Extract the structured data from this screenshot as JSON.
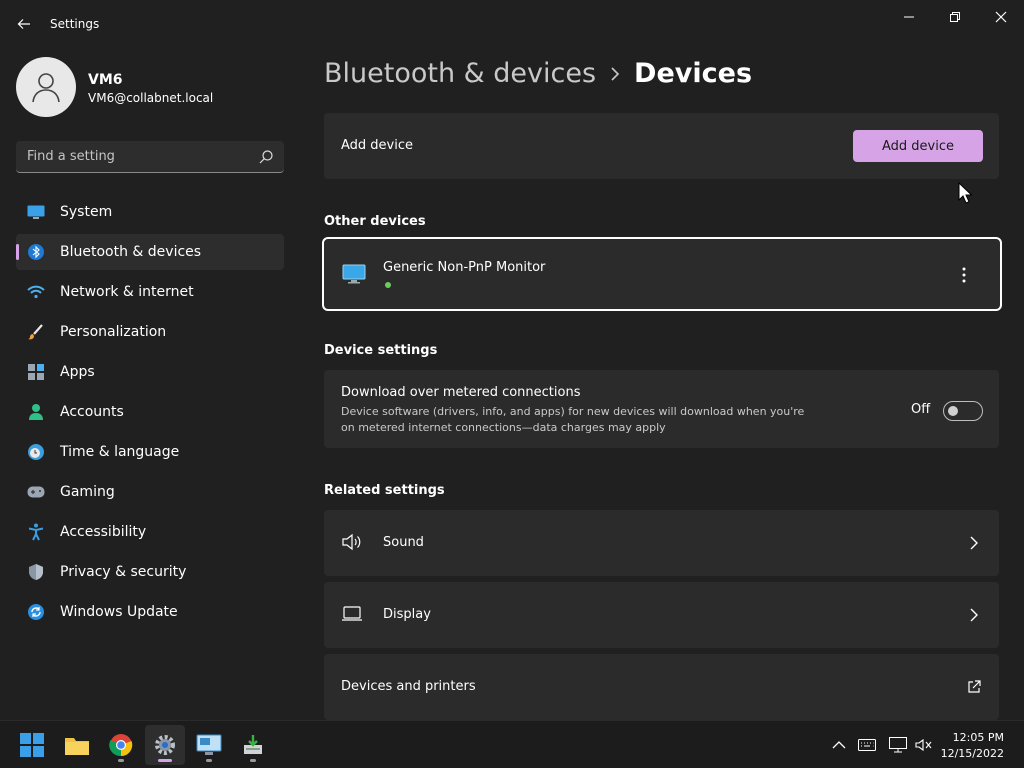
{
  "window": {
    "title": "Settings",
    "controls": [
      "minimize",
      "restore",
      "close"
    ]
  },
  "profile": {
    "name": "VM6",
    "email": "VM6@collabnet.local"
  },
  "search": {
    "placeholder": "Find a setting"
  },
  "sidebar": {
    "items": [
      {
        "label": "System",
        "icon": "system-icon",
        "active": false
      },
      {
        "label": "Bluetooth & devices",
        "icon": "bluetooth-icon",
        "active": true
      },
      {
        "label": "Network & internet",
        "icon": "wifi-icon",
        "active": false
      },
      {
        "label": "Personalization",
        "icon": "brush-icon",
        "active": false
      },
      {
        "label": "Apps",
        "icon": "apps-icon",
        "active": false
      },
      {
        "label": "Accounts",
        "icon": "person-icon",
        "active": false
      },
      {
        "label": "Time & language",
        "icon": "clock-globe-icon",
        "active": false
      },
      {
        "label": "Gaming",
        "icon": "gamepad-icon",
        "active": false
      },
      {
        "label": "Accessibility",
        "icon": "accessibility-icon",
        "active": false
      },
      {
        "label": "Privacy & security",
        "icon": "shield-icon",
        "active": false
      },
      {
        "label": "Windows Update",
        "icon": "update-icon",
        "active": false
      }
    ]
  },
  "main": {
    "breadcrumb_parent": "Bluetooth & devices",
    "breadcrumb_current": "Devices",
    "add_device": {
      "label": "Add device",
      "button_label": "Add device"
    },
    "other_devices": {
      "title": "Other devices",
      "device_name": "Generic Non-PnP Monitor",
      "status": "connected"
    },
    "device_settings": {
      "title": "Device settings",
      "metered": {
        "label": "Download over metered connections",
        "description": "Device software (drivers, info, and apps) for new devices will download when you're on metered internet connections—data charges may apply",
        "toggle_label": "Off",
        "toggle_on": false
      }
    },
    "related": {
      "title": "Related settings",
      "sound": "Sound",
      "display": "Display",
      "printers": "Devices and printers"
    }
  },
  "taskbar": {
    "apps": [
      "start-icon",
      "file-explorer-icon",
      "chrome-icon",
      "settings-icon",
      "remote-desktop-icon",
      "installer-icon"
    ],
    "time": "12:05 PM",
    "date": "12/15/2022"
  },
  "colors": {
    "accent": "#d5a3e6",
    "background": "#202020",
    "card": "#2b2b2b"
  }
}
